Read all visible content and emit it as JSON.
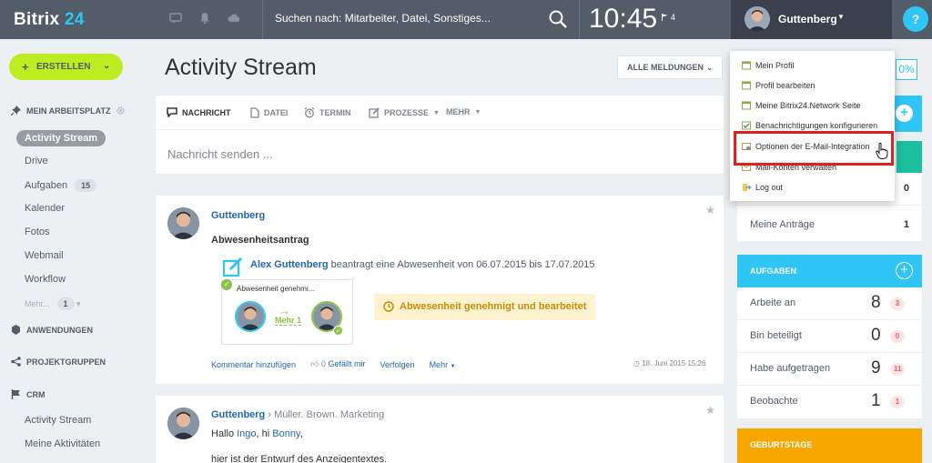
{
  "header": {
    "logo_main": "Bitrix",
    "logo_num": "24",
    "search_placeholder": "Suchen nach: Mitarbeiter, Datei, Sonstiges...",
    "clock": "10:45",
    "flag_count": "4",
    "user_name": "Guttenberg",
    "help": "?"
  },
  "sidebar": {
    "create_label": "ERSTELLEN",
    "my_workplace": "MEIN ARBEITSPLATZ",
    "items": [
      {
        "label": "Activity Stream"
      },
      {
        "label": "Drive"
      },
      {
        "label": "Aufgaben",
        "count": "15"
      },
      {
        "label": "Kalender"
      },
      {
        "label": "Fotos"
      },
      {
        "label": "Webmail"
      },
      {
        "label": "Workflow"
      },
      {
        "label": "Mehr...",
        "count": "1"
      }
    ],
    "applications": "ANWENDUNGEN",
    "project_groups": "PROJEKTGRUPPEN",
    "crm": "CRM",
    "crm_items": [
      {
        "label": "Activity Stream"
      },
      {
        "label": "Meine Aktivitäten"
      }
    ]
  },
  "main": {
    "title": "Activity Stream",
    "filter": "ALLE MELDUNGEN",
    "tabs": [
      "NACHRICHT",
      "DATEI",
      "TERMIN",
      "PROZESSE",
      "MEHR"
    ],
    "compose_placeholder": "Nachricht senden ..."
  },
  "post1": {
    "author": "Guttenberg",
    "title": "Abwesenheitsantrag",
    "requester": "Alex Guttenberg",
    "request_text": " beantragt eine Abwesenheit von 06.07.2015 bis 17.07.2015",
    "wf_title": "Abwesenheit genehmi...",
    "wf_more": "Mehr 1",
    "status": "Abwesenheit genehmigt und bearbeitet",
    "actions": {
      "comment": "Kommentar hinzufügen",
      "like_count": "0",
      "like": "Gefällt mir",
      "follow": "Verfolgen",
      "more": "Mehr"
    },
    "timestamp": "18. Juni 2015 15:26"
  },
  "post2": {
    "author": "Guttenberg",
    "recipients": "Müller. Brown. Marketing",
    "greeting_start": "Hallo ",
    "name1": "Ingo",
    "greeting_mid": ", hi ",
    "name2": "Bonny",
    "greeting_end": ",",
    "line2": "hier ist der Entwurf des Anzeigentextes."
  },
  "right": {
    "progress": "0%",
    "rows_top": [
      {
        "label": "",
        "value": "0"
      },
      {
        "label": "Meine Anträge",
        "value": "1"
      }
    ],
    "tasks_title": "AUFGABEN",
    "tasks": [
      {
        "label": "Arbeite an",
        "count": "8",
        "badge": "3"
      },
      {
        "label": "Bin beteiligt",
        "count": "0",
        "badge": "0"
      },
      {
        "label": "Habe aufgetragen",
        "count": "9",
        "badge": "11"
      },
      {
        "label": "Beobachte",
        "count": "1",
        "badge": "1"
      }
    ],
    "birthdays_title": "GEBURTSTAGE"
  },
  "dropdown": {
    "items": [
      {
        "label": "Mein Profil"
      },
      {
        "label": "Profil bearbeiten"
      },
      {
        "label": "Meine Bitrix24.Network Seite"
      },
      {
        "label": "Benachrichtigungen konfigurieren"
      },
      {
        "label": "Optionen der E-Mail-Integration"
      },
      {
        "label": "Mail-Konten verwalten"
      },
      {
        "label": "Log out"
      }
    ]
  },
  "colors": {
    "topbar": "#535c69",
    "accent": "#2fc6f6",
    "create": "#bbed21",
    "tasks_header": "#2fc6f6",
    "birthday_header": "#f7a700",
    "highlight": "#e02020"
  }
}
